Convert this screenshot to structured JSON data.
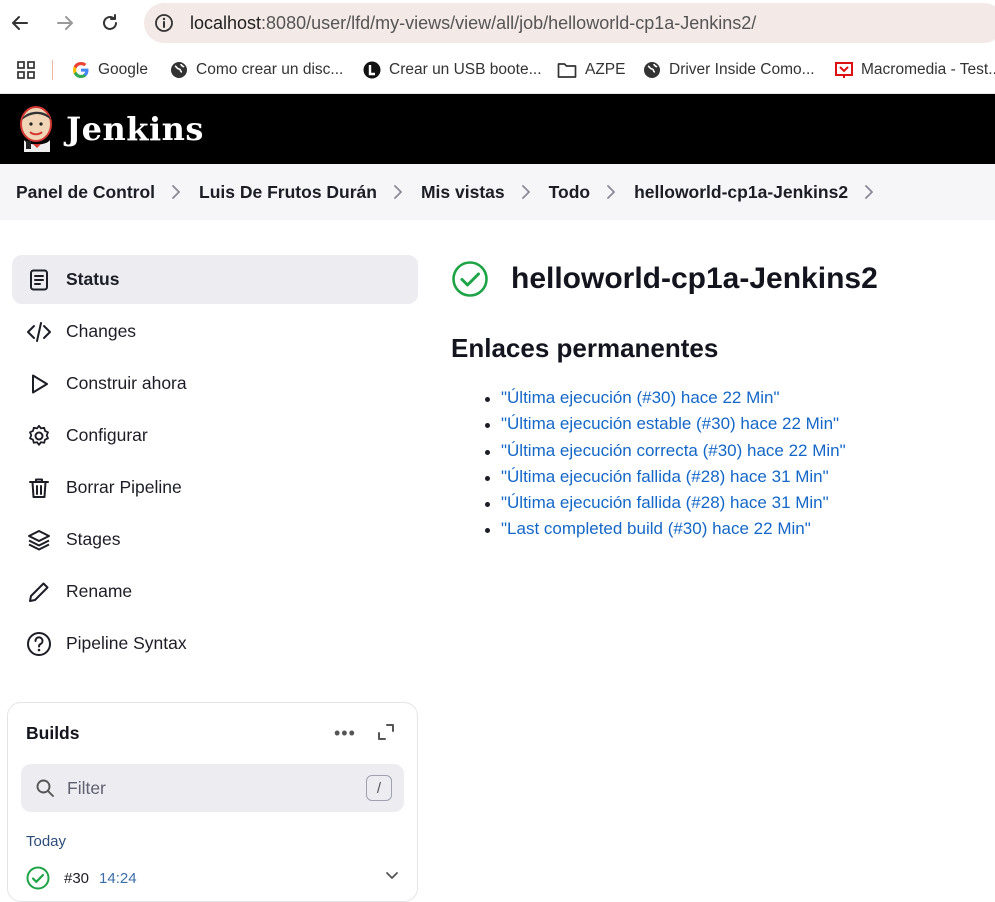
{
  "browser": {
    "url_host": "localhost",
    "url_path": ":8080/user/lfd/my-views/view/all/job/helloworld-cp1a-Jenkins2/",
    "icons": {
      "back": "arrow-left-icon",
      "forward": "arrow-right-icon",
      "reload": "reload-icon",
      "info": "info-icon",
      "apps": "apps-grid-icon"
    }
  },
  "bookmarks": [
    {
      "label": "Google",
      "icon": "google-icon"
    },
    {
      "label": "Como crear un disc...",
      "icon": "globe-icon"
    },
    {
      "label": "Crear un USB boote...",
      "icon": "l-logo-icon"
    },
    {
      "label": "AZPE",
      "icon": "folder-icon"
    },
    {
      "label": "Driver Inside Como...",
      "icon": "globe-icon"
    },
    {
      "label": "Macromedia - Test...",
      "icon": "macromedia-icon"
    }
  ],
  "header": {
    "title": "Jenkins",
    "logo": "jenkins-logo"
  },
  "breadcrumb": [
    "Panel de Control",
    "Luis De Frutos Durán",
    "Mis vistas",
    "Todo",
    "helloworld-cp1a-Jenkins2"
  ],
  "sidebar": {
    "items": [
      {
        "label": "Status",
        "icon": "document-icon",
        "active": true
      },
      {
        "label": "Changes",
        "icon": "code-icon"
      },
      {
        "label": "Construir ahora",
        "icon": "play-icon"
      },
      {
        "label": "Configurar",
        "icon": "gear-icon"
      },
      {
        "label": "Borrar Pipeline",
        "icon": "trash-icon"
      },
      {
        "label": "Stages",
        "icon": "layers-icon"
      },
      {
        "label": "Rename",
        "icon": "pencil-icon"
      },
      {
        "label": "Pipeline Syntax",
        "icon": "help-circle-icon"
      }
    ]
  },
  "builds": {
    "title": "Builds",
    "more": "•••",
    "filter_placeholder": "Filter",
    "filter_shortcut": "/",
    "group_label": "Today",
    "rows": [
      {
        "number": "#30",
        "time": "14:24",
        "status": "success"
      }
    ]
  },
  "main": {
    "job_title": "helloworld-cp1a-Jenkins2",
    "status": "success",
    "permalinks_title": "Enlaces permanentes",
    "permalinks": [
      "\"Última ejecución (#30) hace 22 Min\"",
      "\"Última ejecución estable (#30) hace 22 Min\"",
      "\"Última ejecución correcta (#30) hace 22 Min\"",
      "\"Última ejecución fallida (#28) hace 31 Min\"",
      "\"Última ejecución fallida (#28) hace 31 Min\"",
      "\"Last completed build (#30) hace 22 Min\""
    ]
  },
  "colors": {
    "success": "#1ea446",
    "link": "#1467c7",
    "header_bg": "#000000"
  }
}
